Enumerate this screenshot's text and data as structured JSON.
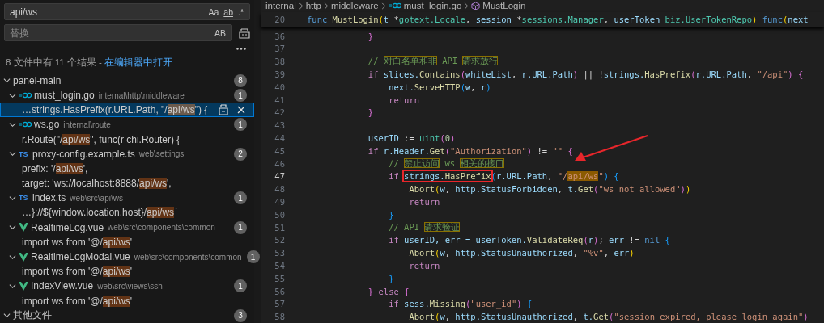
{
  "search": {
    "value": "api/ws",
    "options": [
      "Aa",
      "ab",
      ".*"
    ]
  },
  "replace": {
    "placeholder": "替换",
    "options": [
      "AB"
    ]
  },
  "summary": {
    "text": "8 文件中有 11 个结果 - ",
    "link": "在编辑器中打开"
  },
  "results": [
    {
      "name": "panel-main",
      "count": "8",
      "expanded": true,
      "files": [
        {
          "kind": "go",
          "name": "must_login.go",
          "path": "internal\\http\\middleware",
          "count": "1",
          "expanded": true,
          "matches": [
            {
              "before": "…strings.HasPrefix(r.URL.Path, \"/",
              "match": "api/ws",
              "after": "\") {",
              "selected": true
            }
          ]
        },
        {
          "kind": "go",
          "name": "ws.go",
          "path": "internal\\route",
          "count": "1",
          "expanded": true,
          "matches": [
            {
              "before": "r.Route(\"/",
              "match": "api/ws",
              "after": "\", func(r chi.Router) {",
              "selected": false
            }
          ]
        },
        {
          "kind": "ts",
          "icon_text": "TS",
          "name": "proxy-config.example.ts",
          "path": "web\\settings",
          "count": "2",
          "expanded": true,
          "matches": [
            {
              "before": "prefix: '/",
              "match": "api/ws",
              "after": "',",
              "selected": false
            },
            {
              "before": "target: 'ws://localhost:8888/",
              "match": "api/ws",
              "after": "',",
              "selected": false
            }
          ]
        },
        {
          "kind": "ts",
          "icon_text": "TS",
          "name": "index.ts",
          "path": "web\\src\\api\\ws",
          "count": "1",
          "expanded": true,
          "matches": [
            {
              "before": "…}://${window.location.host}/",
              "match": "api/ws",
              "after": "`",
              "selected": false
            }
          ]
        },
        {
          "kind": "vue",
          "name": "RealtimeLog.vue",
          "path": "web\\src\\components\\common",
          "count": "1",
          "expanded": true,
          "matches": [
            {
              "before": "import ws from '@/",
              "match": "api/ws",
              "after": "'",
              "selected": false
            }
          ]
        },
        {
          "kind": "vue",
          "name": "RealtimeLogModal.vue",
          "path": "web\\src\\components\\common",
          "count": "1",
          "expanded": true,
          "matches": [
            {
              "before": "import ws from '@/",
              "match": "api/ws",
              "after": "'",
              "selected": false
            }
          ]
        },
        {
          "kind": "vue",
          "name": "IndexView.vue",
          "path": "web\\src\\views\\ssh",
          "count": "1",
          "expanded": true,
          "matches": [
            {
              "before": "import ws from '@/",
              "match": "api/ws",
              "after": "'",
              "selected": false
            }
          ]
        }
      ]
    },
    {
      "name": "其他文件",
      "count": "3",
      "expanded": true
    }
  ],
  "breadcrumb": [
    {
      "kind": "folder",
      "label": "internal"
    },
    {
      "kind": "folder",
      "label": "http"
    },
    {
      "kind": "folder",
      "label": "middleware"
    },
    {
      "kind": "go",
      "label": "must_login.go"
    },
    {
      "kind": "symbol",
      "label": "MustLogin"
    }
  ],
  "sticky_line": {
    "number": "20",
    "tokens": [
      {
        "text": "func",
        "kind": "kw"
      },
      {
        "text": " MustLogin",
        "kind": "fn"
      },
      {
        "text": "(",
        "kind": "b1"
      },
      {
        "text": "t ",
        "kind": "var"
      },
      {
        "text": "*",
        "kind": "op"
      },
      {
        "text": "gotext.Locale",
        "kind": "type"
      },
      {
        "text": ", ",
        "kind": "op"
      },
      {
        "text": "session ",
        "kind": "var"
      },
      {
        "text": "*",
        "kind": "op"
      },
      {
        "text": "sessions.Manager",
        "kind": "type"
      },
      {
        "text": ", ",
        "kind": "op"
      },
      {
        "text": "userToken ",
        "kind": "var"
      },
      {
        "text": "biz.UserTokenRepo",
        "kind": "type"
      },
      {
        "text": ")",
        "kind": "b1"
      },
      {
        "text": " func",
        "kind": "kw"
      },
      {
        "text": "(",
        "kind": "b1"
      },
      {
        "text": "next",
        "kind": "var"
      }
    ]
  },
  "code_lines": [
    {
      "number": "36",
      "current": false,
      "tokens": [
        {
          "text": "            }",
          "kind": "b2"
        }
      ]
    },
    {
      "number": "37",
      "current": false
    },
    {
      "number": "38",
      "current": false,
      "tokens": [
        {
          "text": "            // ",
          "kind": "cmt"
        },
        {
          "text": "对白名单和非",
          "kind": "cmt",
          "ambiguous": true
        },
        {
          "text": " API ",
          "kind": "cmt"
        },
        {
          "text": "请求放行",
          "kind": "cmt",
          "ambiguous": true
        }
      ]
    },
    {
      "number": "39",
      "current": false,
      "tokens": [
        {
          "text": "            if",
          "kind": "ctl"
        },
        {
          "text": " slices.",
          "kind": "var"
        },
        {
          "text": "Contains",
          "kind": "fn"
        },
        {
          "text": "(",
          "kind": "b2"
        },
        {
          "text": "whiteList",
          "kind": "var"
        },
        {
          "text": ", ",
          "kind": "op"
        },
        {
          "text": "r.URL.Path",
          "kind": "var"
        },
        {
          "text": ")",
          "kind": "b2"
        },
        {
          "text": " || !",
          "kind": "op"
        },
        {
          "text": "strings.",
          "kind": "var"
        },
        {
          "text": "HasPrefix",
          "kind": "fn"
        },
        {
          "text": "(",
          "kind": "b2"
        },
        {
          "text": "r.URL.Path",
          "kind": "var"
        },
        {
          "text": ", ",
          "kind": "op"
        },
        {
          "text": "\"/api\"",
          "kind": "str"
        },
        {
          "text": ")",
          "kind": "b2"
        },
        {
          "text": " {",
          "kind": "b2"
        }
      ]
    },
    {
      "number": "40",
      "current": false,
      "tokens": [
        {
          "text": "                next.",
          "kind": "var"
        },
        {
          "text": "ServeHTTP",
          "kind": "fn"
        },
        {
          "text": "(",
          "kind": "b3"
        },
        {
          "text": "w",
          "kind": "var"
        },
        {
          "text": ", ",
          "kind": "op"
        },
        {
          "text": "r",
          "kind": "var"
        },
        {
          "text": ")",
          "kind": "b3"
        }
      ]
    },
    {
      "number": "41",
      "current": false,
      "tokens": [
        {
          "text": "                return",
          "kind": "ctl"
        }
      ]
    },
    {
      "number": "42",
      "current": false,
      "tokens": [
        {
          "text": "            }",
          "kind": "b2"
        }
      ]
    },
    {
      "number": "43",
      "current": false
    },
    {
      "number": "44",
      "current": false,
      "tokens": [
        {
          "text": "            userID",
          "kind": "var"
        },
        {
          "text": " := ",
          "kind": "op"
        },
        {
          "text": "uint",
          "kind": "type"
        },
        {
          "text": "(",
          "kind": "b2"
        },
        {
          "text": "0",
          "kind": "num"
        },
        {
          "text": ")",
          "kind": "b2"
        }
      ]
    },
    {
      "number": "45",
      "current": false,
      "tokens": [
        {
          "text": "            if",
          "kind": "ctl"
        },
        {
          "text": " r.Header.",
          "kind": "var"
        },
        {
          "text": "Get",
          "kind": "fn"
        },
        {
          "text": "(",
          "kind": "b2"
        },
        {
          "text": "\"Authorization\"",
          "kind": "str"
        },
        {
          "text": ")",
          "kind": "b2"
        },
        {
          "text": " != ",
          "kind": "op"
        },
        {
          "text": "\"\"",
          "kind": "str"
        },
        {
          "text": " {",
          "kind": "b2"
        }
      ]
    },
    {
      "number": "46",
      "current": false,
      "tokens": [
        {
          "text": "                // ",
          "kind": "cmt"
        },
        {
          "text": "禁止访问",
          "kind": "cmt",
          "ambiguous": true
        },
        {
          "text": " ws ",
          "kind": "cmt"
        },
        {
          "text": "相关的接口",
          "kind": "cmt",
          "ambiguous": true
        }
      ]
    },
    {
      "number": "47",
      "current": true,
      "tokens": [
        {
          "text": "                if ",
          "kind": "ctl"
        },
        {
          "text": "strings.",
          "kind": "var",
          "annotated": true
        },
        {
          "text": "HasPrefix",
          "kind": "fn",
          "annotated": true
        },
        {
          "text": "(",
          "kind": "b3"
        },
        {
          "text": "r.URL.Path",
          "kind": "var"
        },
        {
          "text": ", ",
          "kind": "op"
        },
        {
          "text": "\"/",
          "kind": "str"
        },
        {
          "text": "api/ws",
          "kind": "str",
          "match": true
        },
        {
          "text": "\"",
          "kind": "str"
        },
        {
          "text": ")",
          "kind": "b3"
        },
        {
          "text": " {",
          "kind": "b3"
        }
      ]
    },
    {
      "number": "48",
      "current": false,
      "tokens": [
        {
          "text": "                    Abort",
          "kind": "fn"
        },
        {
          "text": "(",
          "kind": "b1"
        },
        {
          "text": "w",
          "kind": "var"
        },
        {
          "text": ", ",
          "kind": "op"
        },
        {
          "text": "http.StatusForbidden",
          "kind": "var"
        },
        {
          "text": ", ",
          "kind": "op"
        },
        {
          "text": "t.",
          "kind": "var"
        },
        {
          "text": "Get",
          "kind": "fn"
        },
        {
          "text": "(",
          "kind": "b2"
        },
        {
          "text": "\"ws not allowed\"",
          "kind": "str"
        },
        {
          "text": ")",
          "kind": "b2"
        },
        {
          "text": ")",
          "kind": "b1"
        }
      ]
    },
    {
      "number": "49",
      "current": false,
      "tokens": [
        {
          "text": "                    return",
          "kind": "ctl"
        }
      ]
    },
    {
      "number": "50",
      "current": false,
      "tokens": [
        {
          "text": "                }",
          "kind": "b3"
        }
      ]
    },
    {
      "number": "51",
      "current": false,
      "tokens": [
        {
          "text": "                // API ",
          "kind": "cmt"
        },
        {
          "text": "请求验证",
          "kind": "cmt",
          "ambiguous": true
        }
      ]
    },
    {
      "number": "52",
      "current": false,
      "tokens": [
        {
          "text": "                if",
          "kind": "ctl"
        },
        {
          "text": " userID, err = userToken.",
          "kind": "var"
        },
        {
          "text": "ValidateReq",
          "kind": "fn"
        },
        {
          "text": "(",
          "kind": "b2"
        },
        {
          "text": "r",
          "kind": "var"
        },
        {
          "text": ")",
          "kind": "b2"
        },
        {
          "text": "; ",
          "kind": "op"
        },
        {
          "text": "err",
          "kind": "var"
        },
        {
          "text": " != ",
          "kind": "op"
        },
        {
          "text": "nil",
          "kind": "kw"
        },
        {
          "text": " {",
          "kind": "b3"
        }
      ]
    },
    {
      "number": "53",
      "current": false,
      "tokens": [
        {
          "text": "                    Abort",
          "kind": "fn"
        },
        {
          "text": "(",
          "kind": "b1"
        },
        {
          "text": "w",
          "kind": "var"
        },
        {
          "text": ", ",
          "kind": "op"
        },
        {
          "text": "http.StatusUnauthorized",
          "kind": "var"
        },
        {
          "text": ", ",
          "kind": "op"
        },
        {
          "text": "\"%v\"",
          "kind": "str"
        },
        {
          "text": ", ",
          "kind": "op"
        },
        {
          "text": "err",
          "kind": "var"
        },
        {
          "text": ")",
          "kind": "b1"
        }
      ]
    },
    {
      "number": "54",
      "current": false,
      "tokens": [
        {
          "text": "                    return",
          "kind": "ctl"
        }
      ]
    },
    {
      "number": "55",
      "current": false,
      "tokens": [
        {
          "text": "                }",
          "kind": "b3"
        }
      ]
    },
    {
      "number": "56",
      "current": false,
      "tokens": [
        {
          "text": "            }",
          "kind": "b2"
        },
        {
          "text": " else ",
          "kind": "ctl"
        },
        {
          "text": "{",
          "kind": "b2"
        }
      ]
    },
    {
      "number": "57",
      "current": false,
      "tokens": [
        {
          "text": "                if",
          "kind": "ctl"
        },
        {
          "text": " sess.",
          "kind": "var"
        },
        {
          "text": "Missing",
          "kind": "fn"
        },
        {
          "text": "(",
          "kind": "b2"
        },
        {
          "text": "\"user_id\"",
          "kind": "str"
        },
        {
          "text": ")",
          "kind": "b2"
        },
        {
          "text": " {",
          "kind": "b3"
        }
      ]
    },
    {
      "number": "58",
      "current": false,
      "tokens": [
        {
          "text": "                    Abort",
          "kind": "fn"
        },
        {
          "text": "(",
          "kind": "b1"
        },
        {
          "text": "w",
          "kind": "var"
        },
        {
          "text": ", ",
          "kind": "op"
        },
        {
          "text": "http.StatusUnauthorized",
          "kind": "var"
        },
        {
          "text": ", ",
          "kind": "op"
        },
        {
          "text": "t.",
          "kind": "var"
        },
        {
          "text": "Get",
          "kind": "fn"
        },
        {
          "text": "(",
          "kind": "b2"
        },
        {
          "text": "\"session expired, please login again\"",
          "kind": "str"
        },
        {
          "text": ")",
          "kind": "b2"
        }
      ]
    }
  ],
  "annotations": [
    {
      "kind": "arrow"
    }
  ]
}
